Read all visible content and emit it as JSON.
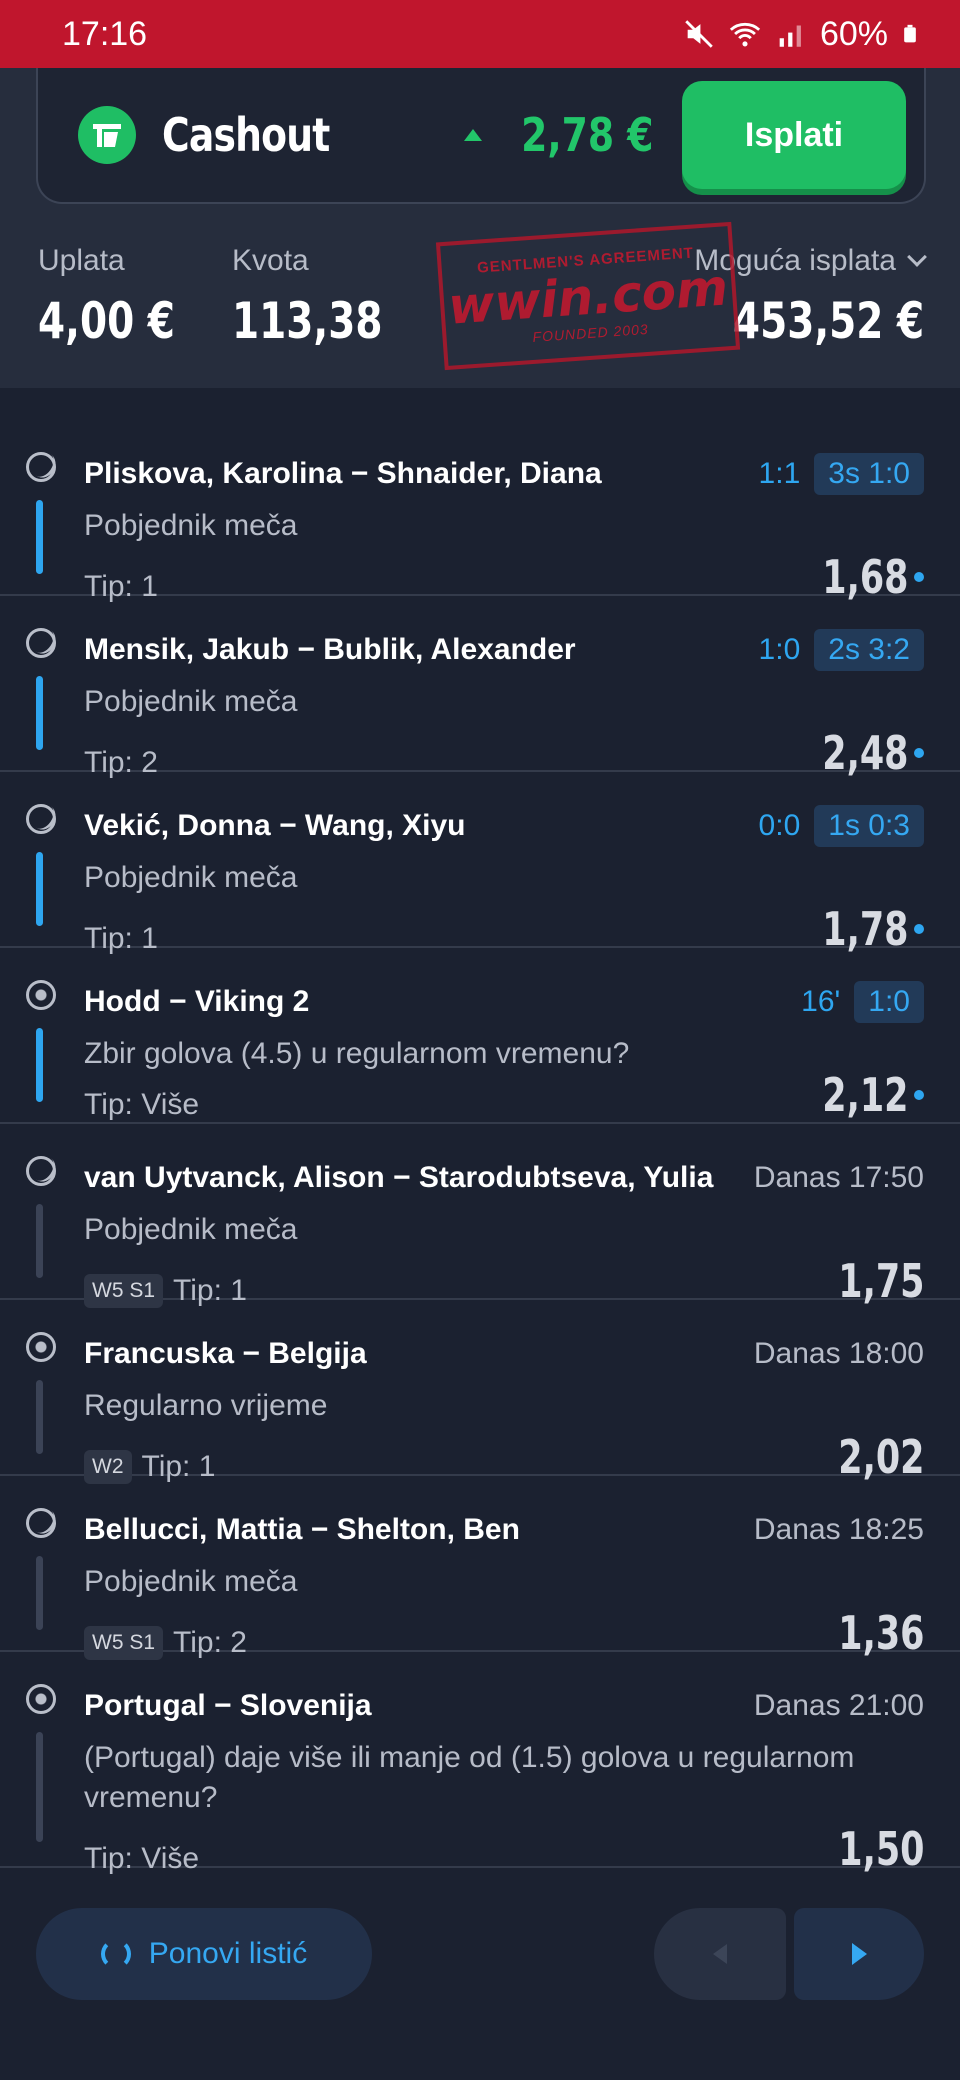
{
  "status_bar": {
    "time": "17:16",
    "battery": "60%",
    "icons": [
      "mute-icon",
      "wifi-icon",
      "signal-icon",
      "battery-icon"
    ]
  },
  "cashout": {
    "title": "Cashout",
    "value": "2,78 €",
    "button_label": "Isplati"
  },
  "summary": {
    "uplata_label": "Uplata",
    "uplata_value": "4,00 €",
    "kvota_label": "Kvota",
    "kvota_value": "113,38",
    "isplata_label": "Moguća isplata",
    "isplata_value": "453,52 €"
  },
  "stamp": {
    "top": "GENTLMEN'S AGREEMENT",
    "brand": "wwin.com",
    "bottom": "FOUNDED 2003"
  },
  "bets": [
    {
      "sport": "tennis",
      "teams": "Pliskova, Karolina − Shnaider, Diana",
      "live": true,
      "score": "1:1",
      "set": "3s 1:0",
      "market": "Pobjednik meča",
      "tags": [],
      "tip": "Tip: 1",
      "odd": "1,68"
    },
    {
      "sport": "tennis",
      "teams": "Mensik, Jakub − Bublik, Alexander",
      "live": true,
      "score": "1:0",
      "set": "2s 3:2",
      "market": "Pobjednik meča",
      "tags": [],
      "tip": "Tip: 2",
      "odd": "2,48"
    },
    {
      "sport": "tennis",
      "teams": "Vekić, Donna − Wang, Xiyu",
      "live": true,
      "score": "0:0",
      "set": "1s 0:3",
      "market": "Pobjednik meča",
      "tags": [],
      "tip": "Tip: 1",
      "odd": "1,78"
    },
    {
      "sport": "football",
      "teams": "Hodd − Viking 2",
      "live": true,
      "score": "16'",
      "set": "1:0",
      "market": "Zbir golova (4.5) u regularnom vremenu?",
      "tags": [],
      "tip": "Tip: Više",
      "odd": "2,12"
    },
    {
      "sport": "tennis",
      "teams": "van Uytvanck, Alison − Starodubtseva, Yulia",
      "live": false,
      "time": "Danas 17:50",
      "market": "Pobjednik meča",
      "tags": [
        "W5 S1"
      ],
      "tip": "Tip: 1",
      "odd": "1,75"
    },
    {
      "sport": "football",
      "teams": "Francuska − Belgija",
      "live": false,
      "time": "Danas 18:00",
      "market": "Regularno vrijeme",
      "tags": [
        "W2"
      ],
      "tip": "Tip: 1",
      "odd": "2,02"
    },
    {
      "sport": "tennis",
      "teams": "Bellucci, Mattia − Shelton, Ben",
      "live": false,
      "time": "Danas 18:25",
      "market": "Pobjednik meča",
      "tags": [
        "W5 S1"
      ],
      "tip": "Tip: 2",
      "odd": "1,36"
    },
    {
      "sport": "football",
      "teams": "Portugal − Slovenija",
      "live": false,
      "time": "Danas 21:00",
      "market": "(Portugal) daje više ili manje od (1.5) golova u regularnom vremenu?",
      "tags": [],
      "tip": "Tip: Više",
      "odd": "1,50"
    }
  ],
  "footer": {
    "repeat_label": "Ponovi listić"
  }
}
